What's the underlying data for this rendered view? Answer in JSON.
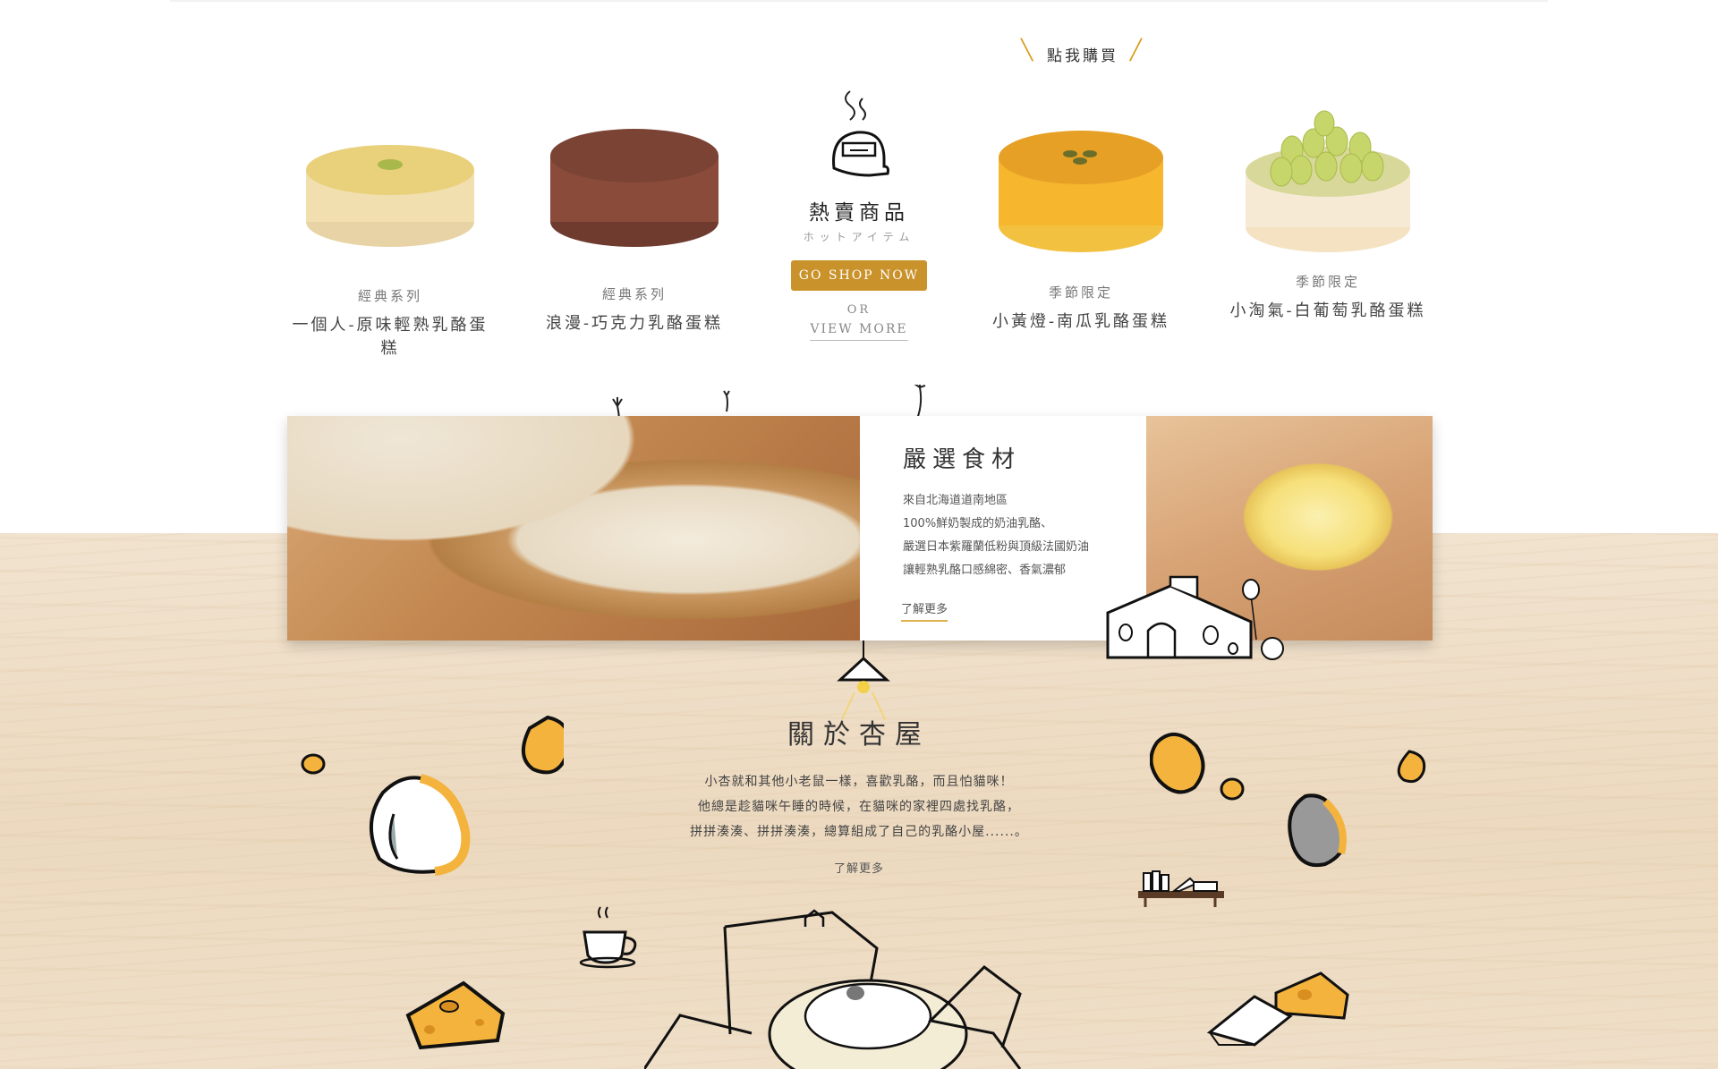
{
  "hot": {
    "title": "熱賣商品",
    "subtitle": "ホットアイテム",
    "shop_button": "GO SHOP NOW",
    "or_text": "OR",
    "view_more": "VIEW MORE",
    "buy_label": "點我購買"
  },
  "products": [
    {
      "series": "經典系列",
      "name": "一個人-原味輕熟乳酪蛋糕"
    },
    {
      "series": "經典系列",
      "name": "浪漫-巧克力乳酪蛋糕"
    },
    {
      "series": "季節限定",
      "name": "小黃燈-南瓜乳酪蛋糕"
    },
    {
      "series": "季節限定",
      "name": "小淘氣-白葡萄乳酪蛋糕"
    }
  ],
  "ingredients": {
    "title": "嚴選食材",
    "lines": [
      "來自北海道道南地區",
      "100%鮮奶製成的奶油乳酪、",
      "嚴選日本紫羅蘭低粉與頂級法國奶油",
      "讓輕熟乳酪口感綿密、香氣濃郁"
    ],
    "learn_more": "了解更多"
  },
  "about": {
    "title": "關於杏屋",
    "lines": [
      "小杏就和其他小老鼠一樣，喜歡乳酪，而且怕貓咪！",
      "他總是趁貓咪午睡的時候，在貓咪的家裡四處找乳酪，",
      "拼拼湊湊、拼拼湊湊，總算組成了自己的乳酪小屋......。"
    ],
    "learn_more": "了解更多"
  },
  "colors": {
    "accent": "#c9922a",
    "cheese": "#f3b33d",
    "wood": "#ecd9bf"
  }
}
